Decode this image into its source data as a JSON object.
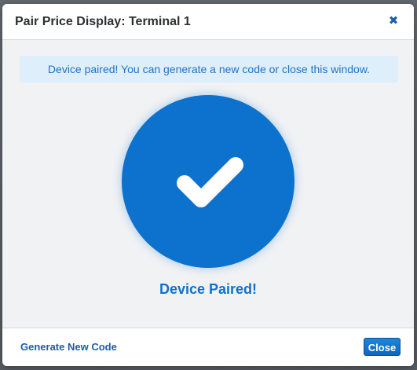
{
  "modal": {
    "title": "Pair Price Display: Terminal 1",
    "close_icon": "close-icon",
    "close_glyph": "✖"
  },
  "alert": {
    "message": "Device paired! You can generate a new code or close this window."
  },
  "status": {
    "icon": "checkmark-icon",
    "label": "Device Paired!"
  },
  "footer": {
    "generate_label": "Generate New Code",
    "close_label": "Close"
  },
  "colors": {
    "accent": "#0d72cd",
    "alert_bg": "#dfeefb",
    "alert_text": "#1f74c4",
    "link": "#1a5ea8"
  }
}
